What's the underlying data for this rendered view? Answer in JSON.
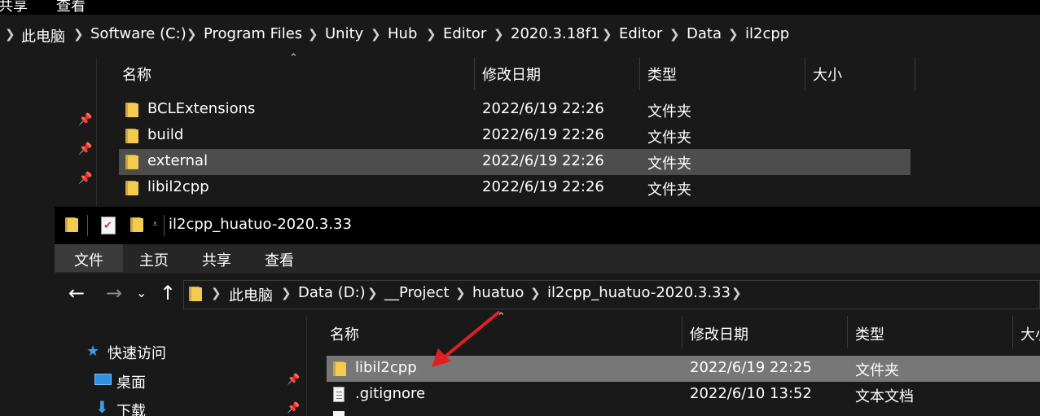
{
  "back_window": {
    "ribbon_tabs": [
      "共享",
      "查看"
    ],
    "breadcrumbs": [
      "此电脑",
      "Software (C:)",
      "Program Files",
      "Unity",
      "Hub",
      "Editor",
      "2020.3.18f1",
      "Editor",
      "Data",
      "il2cpp"
    ],
    "columns": [
      "名称",
      "修改日期",
      "类型",
      "大小"
    ],
    "rows": [
      {
        "name": "BCLExtensions",
        "date": "2022/6/19 22:26",
        "type": "文件夹"
      },
      {
        "name": "build",
        "date": "2022/6/19 22:26",
        "type": "文件夹"
      },
      {
        "name": "external",
        "date": "2022/6/19 22:26",
        "type": "文件夹"
      },
      {
        "name": "libil2cpp",
        "date": "2022/6/19 22:26",
        "type": "文件夹"
      }
    ]
  },
  "front_window": {
    "title": "il2cpp_huatuo-2020.3.33",
    "ribbon_tabs": [
      "文件",
      "主页",
      "共享",
      "查看"
    ],
    "breadcrumbs": [
      "此电脑",
      "Data (D:)",
      "__Project",
      "huatuo",
      "il2cpp_huatuo-2020.3.33"
    ],
    "nav": {
      "quick_access": "快速访问",
      "desktop": "桌面",
      "downloads": "下载"
    },
    "columns": [
      "名称",
      "修改日期",
      "类型",
      "大小"
    ],
    "rows": [
      {
        "name": "libil2cpp",
        "date": "2022/6/19 22:25",
        "type": "文件夹",
        "icon": "folder-icon"
      },
      {
        "name": ".gitignore",
        "date": "2022/6/10 13:52",
        "type": "文本文档",
        "icon": "file-icon"
      }
    ]
  },
  "colors": {
    "accent_arrow": "#e02020",
    "folder": "#f2cb50",
    "selection": "#777777"
  }
}
